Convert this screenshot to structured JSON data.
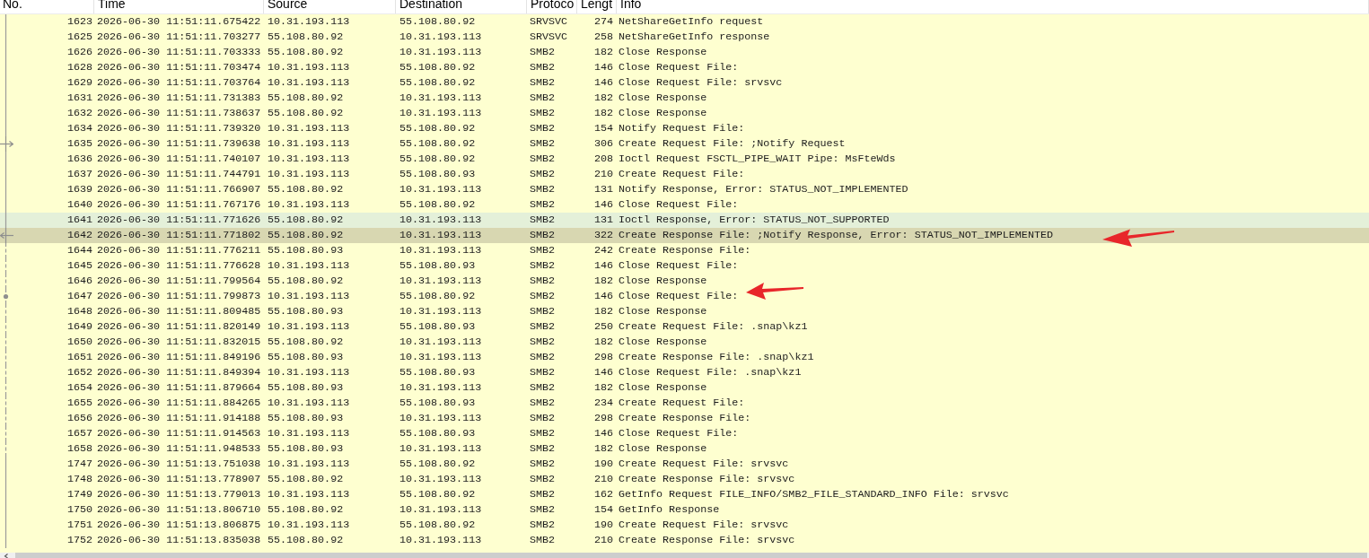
{
  "packet_list": {
    "columns": [
      "No.",
      "Time",
      "Source",
      "Destination",
      "Protoco",
      "Lengt",
      "Info"
    ],
    "rows": [
      {
        "no": "1623",
        "time": "2026-06-30 11:51:11.675422",
        "source": "10.31.193.113",
        "destination": "55.108.80.92",
        "protocol": "SRVSVC",
        "length": "274",
        "info": "NetShareGetInfo request",
        "selected": false,
        "hovered": false,
        "kind": "line",
        "in_conversation": true
      },
      {
        "no": "1625",
        "time": "2026-06-30 11:51:11.703277",
        "source": "55.108.80.92",
        "destination": "10.31.193.113",
        "protocol": "SRVSVC",
        "length": "258",
        "info": "NetShareGetInfo response",
        "selected": false,
        "hovered": false,
        "kind": "line",
        "in_conversation": true
      },
      {
        "no": "1626",
        "time": "2026-06-30 11:51:11.703333",
        "source": "55.108.80.92",
        "destination": "10.31.193.113",
        "protocol": "SMB2",
        "length": "182",
        "info": "Close Response",
        "selected": false,
        "hovered": false,
        "kind": "line",
        "in_conversation": true
      },
      {
        "no": "1628",
        "time": "2026-06-30 11:51:11.703474",
        "source": "10.31.193.113",
        "destination": "55.108.80.92",
        "protocol": "SMB2",
        "length": "146",
        "info": "Close Request File:",
        "selected": false,
        "hovered": false,
        "kind": "line",
        "in_conversation": true
      },
      {
        "no": "1629",
        "time": "2026-06-30 11:51:11.703764",
        "source": "10.31.193.113",
        "destination": "55.108.80.92",
        "protocol": "SMB2",
        "length": "146",
        "info": "Close Request File: srvsvc",
        "selected": false,
        "hovered": false,
        "kind": "line",
        "in_conversation": true
      },
      {
        "no": "1631",
        "time": "2026-06-30 11:51:11.731383",
        "source": "55.108.80.92",
        "destination": "10.31.193.113",
        "protocol": "SMB2",
        "length": "182",
        "info": "Close Response",
        "selected": false,
        "hovered": false,
        "kind": "line",
        "in_conversation": true
      },
      {
        "no": "1632",
        "time": "2026-06-30 11:51:11.738637",
        "source": "55.108.80.92",
        "destination": "10.31.193.113",
        "protocol": "SMB2",
        "length": "182",
        "info": "Close Response",
        "selected": false,
        "hovered": false,
        "kind": "line",
        "in_conversation": true
      },
      {
        "no": "1634",
        "time": "2026-06-30 11:51:11.739320",
        "source": "10.31.193.113",
        "destination": "55.108.80.92",
        "protocol": "SMB2",
        "length": "154",
        "info": "Notify Request File:",
        "selected": false,
        "hovered": false,
        "kind": "line",
        "in_conversation": true
      },
      {
        "no": "1635",
        "time": "2026-06-30 11:51:11.739638",
        "source": "10.31.193.113",
        "destination": "55.108.80.92",
        "protocol": "SMB2",
        "length": "306",
        "info": "Create Request File: ;Notify Request",
        "selected": false,
        "hovered": false,
        "kind": "request",
        "in_conversation": true
      },
      {
        "no": "1636",
        "time": "2026-06-30 11:51:11.740107",
        "source": "10.31.193.113",
        "destination": "55.108.80.92",
        "protocol": "SMB2",
        "length": "208",
        "info": "Ioctl Request FSCTL_PIPE_WAIT Pipe: MsFteWds",
        "selected": false,
        "hovered": false,
        "kind": "line",
        "in_conversation": true
      },
      {
        "no": "1637",
        "time": "2026-06-30 11:51:11.744791",
        "source": "10.31.193.113",
        "destination": "55.108.80.93",
        "protocol": "SMB2",
        "length": "210",
        "info": "Create Request File:",
        "selected": false,
        "hovered": false,
        "kind": "line",
        "in_conversation": true
      },
      {
        "no": "1639",
        "time": "2026-06-30 11:51:11.766907",
        "source": "55.108.80.92",
        "destination": "10.31.193.113",
        "protocol": "SMB2",
        "length": "131",
        "info": "Notify Response, Error: STATUS_NOT_IMPLEMENTED",
        "selected": false,
        "hovered": false,
        "kind": "line",
        "in_conversation": true
      },
      {
        "no": "1640",
        "time": "2026-06-30 11:51:11.767176",
        "source": "10.31.193.113",
        "destination": "55.108.80.92",
        "protocol": "SMB2",
        "length": "146",
        "info": "Close Request File:",
        "selected": false,
        "hovered": false,
        "kind": "line",
        "in_conversation": true
      },
      {
        "no": "1641",
        "time": "2026-06-30 11:51:11.771626",
        "source": "55.108.80.92",
        "destination": "10.31.193.113",
        "protocol": "SMB2",
        "length": "131",
        "info": "Ioctl Response, Error: STATUS_NOT_SUPPORTED",
        "selected": false,
        "hovered": true,
        "kind": "line",
        "in_conversation": true
      },
      {
        "no": "1642",
        "time": "2026-06-30 11:51:11.771802",
        "source": "55.108.80.92",
        "destination": "10.31.193.113",
        "protocol": "SMB2",
        "length": "322",
        "info": "Create Response File: ;Notify Response, Error: STATUS_NOT_IMPLEMENTED",
        "selected": true,
        "hovered": false,
        "kind": "response",
        "in_conversation": true
      },
      {
        "no": "1644",
        "time": "2026-06-30 11:51:11.776211",
        "source": "55.108.80.93",
        "destination": "10.31.193.113",
        "protocol": "SMB2",
        "length": "242",
        "info": "Create Response File:",
        "selected": false,
        "hovered": false,
        "kind": "line",
        "in_conversation": false
      },
      {
        "no": "1645",
        "time": "2026-06-30 11:51:11.776628",
        "source": "10.31.193.113",
        "destination": "55.108.80.93",
        "protocol": "SMB2",
        "length": "146",
        "info": "Close Request File:",
        "selected": false,
        "hovered": false,
        "kind": "line",
        "in_conversation": false
      },
      {
        "no": "1646",
        "time": "2026-06-30 11:51:11.799564",
        "source": "55.108.80.92",
        "destination": "10.31.193.113",
        "protocol": "SMB2",
        "length": "182",
        "info": "Close Response",
        "selected": false,
        "hovered": false,
        "kind": "line",
        "in_conversation": false
      },
      {
        "no": "1647",
        "time": "2026-06-30 11:51:11.799873",
        "source": "10.31.193.113",
        "destination": "55.108.80.92",
        "protocol": "SMB2",
        "length": "146",
        "info": "Close Request File:",
        "selected": false,
        "hovered": false,
        "kind": "related",
        "in_conversation": false
      },
      {
        "no": "1648",
        "time": "2026-06-30 11:51:11.809485",
        "source": "55.108.80.93",
        "destination": "10.31.193.113",
        "protocol": "SMB2",
        "length": "182",
        "info": "Close Response",
        "selected": false,
        "hovered": false,
        "kind": "line",
        "in_conversation": false
      },
      {
        "no": "1649",
        "time": "2026-06-30 11:51:11.820149",
        "source": "10.31.193.113",
        "destination": "55.108.80.93",
        "protocol": "SMB2",
        "length": "250",
        "info": "Create Request File: .snap\\kz1",
        "selected": false,
        "hovered": false,
        "kind": "line",
        "in_conversation": false
      },
      {
        "no": "1650",
        "time": "2026-06-30 11:51:11.832015",
        "source": "55.108.80.92",
        "destination": "10.31.193.113",
        "protocol": "SMB2",
        "length": "182",
        "info": "Close Response",
        "selected": false,
        "hovered": false,
        "kind": "line",
        "in_conversation": false
      },
      {
        "no": "1651",
        "time": "2026-06-30 11:51:11.849196",
        "source": "55.108.80.93",
        "destination": "10.31.193.113",
        "protocol": "SMB2",
        "length": "298",
        "info": "Create Response File: .snap\\kz1",
        "selected": false,
        "hovered": false,
        "kind": "line",
        "in_conversation": false
      },
      {
        "no": "1652",
        "time": "2026-06-30 11:51:11.849394",
        "source": "10.31.193.113",
        "destination": "55.108.80.93",
        "protocol": "SMB2",
        "length": "146",
        "info": "Close Request File: .snap\\kz1",
        "selected": false,
        "hovered": false,
        "kind": "line",
        "in_conversation": false
      },
      {
        "no": "1654",
        "time": "2026-06-30 11:51:11.879664",
        "source": "55.108.80.93",
        "destination": "10.31.193.113",
        "protocol": "SMB2",
        "length": "182",
        "info": "Close Response",
        "selected": false,
        "hovered": false,
        "kind": "line",
        "in_conversation": false
      },
      {
        "no": "1655",
        "time": "2026-06-30 11:51:11.884265",
        "source": "10.31.193.113",
        "destination": "55.108.80.93",
        "protocol": "SMB2",
        "length": "234",
        "info": "Create Request File:",
        "selected": false,
        "hovered": false,
        "kind": "line",
        "in_conversation": false
      },
      {
        "no": "1656",
        "time": "2026-06-30 11:51:11.914188",
        "source": "55.108.80.93",
        "destination": "10.31.193.113",
        "protocol": "SMB2",
        "length": "298",
        "info": "Create Response File:",
        "selected": false,
        "hovered": false,
        "kind": "line",
        "in_conversation": false
      },
      {
        "no": "1657",
        "time": "2026-06-30 11:51:11.914563",
        "source": "10.31.193.113",
        "destination": "55.108.80.93",
        "protocol": "SMB2",
        "length": "146",
        "info": "Close Request File:",
        "selected": false,
        "hovered": false,
        "kind": "line",
        "in_conversation": false
      },
      {
        "no": "1658",
        "time": "2026-06-30 11:51:11.948533",
        "source": "55.108.80.93",
        "destination": "10.31.193.113",
        "protocol": "SMB2",
        "length": "182",
        "info": "Close Response",
        "selected": false,
        "hovered": false,
        "kind": "line",
        "in_conversation": false
      },
      {
        "no": "1747",
        "time": "2026-06-30 11:51:13.751038",
        "source": "10.31.193.113",
        "destination": "55.108.80.92",
        "protocol": "SMB2",
        "length": "190",
        "info": "Create Request File: srvsvc",
        "selected": false,
        "hovered": false,
        "kind": "line",
        "in_conversation": true
      },
      {
        "no": "1748",
        "time": "2026-06-30 11:51:13.778907",
        "source": "55.108.80.92",
        "destination": "10.31.193.113",
        "protocol": "SMB2",
        "length": "210",
        "info": "Create Response File: srvsvc",
        "selected": false,
        "hovered": false,
        "kind": "line",
        "in_conversation": true
      },
      {
        "no": "1749",
        "time": "2026-06-30 11:51:13.779013",
        "source": "10.31.193.113",
        "destination": "55.108.80.92",
        "protocol": "SMB2",
        "length": "162",
        "info": "GetInfo Request FILE_INFO/SMB2_FILE_STANDARD_INFO File: srvsvc",
        "selected": false,
        "hovered": false,
        "kind": "line",
        "in_conversation": true
      },
      {
        "no": "1750",
        "time": "2026-06-30 11:51:13.806710",
        "source": "55.108.80.92",
        "destination": "10.31.193.113",
        "protocol": "SMB2",
        "length": "154",
        "info": "GetInfo Response",
        "selected": false,
        "hovered": false,
        "kind": "line",
        "in_conversation": true
      },
      {
        "no": "1751",
        "time": "2026-06-30 11:51:13.806875",
        "source": "10.31.193.113",
        "destination": "55.108.80.92",
        "protocol": "SMB2",
        "length": "190",
        "info": "Create Request File: srvsvc",
        "selected": false,
        "hovered": false,
        "kind": "line",
        "in_conversation": true
      },
      {
        "no": "1752",
        "time": "2026-06-30 11:51:13.835038",
        "source": "55.108.80.92",
        "destination": "10.31.193.113",
        "protocol": "SMB2",
        "length": "210",
        "info": "Create Response File: srvsvc",
        "selected": false,
        "hovered": false,
        "kind": "line",
        "in_conversation": true
      }
    ]
  },
  "annotations": [
    {
      "kind": "arrow"
    },
    {
      "kind": "arrow"
    }
  ]
}
